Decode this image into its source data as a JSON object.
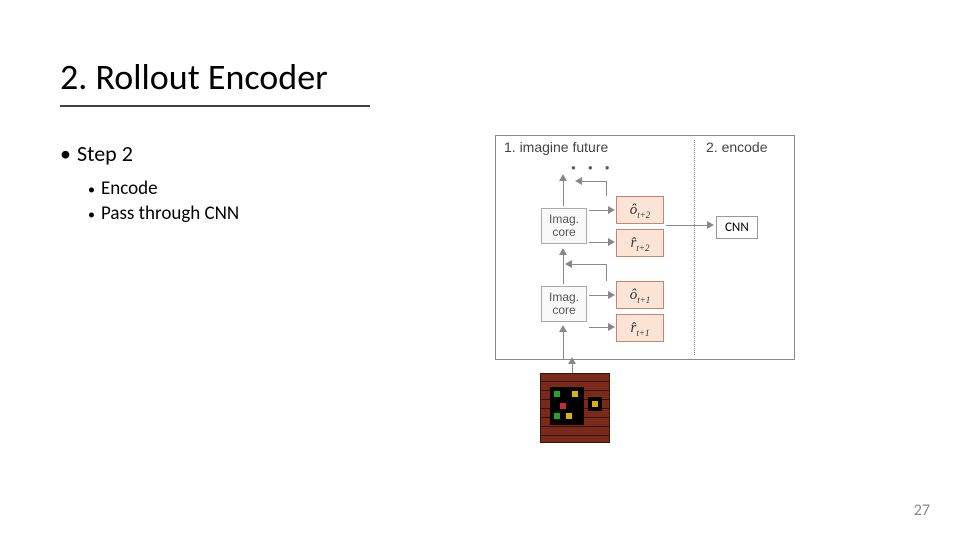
{
  "title": "2. Rollout Encoder",
  "bullet_step": "Step 2",
  "sub_bullets": [
    "Encode",
    "Pass through CNN"
  ],
  "diagram": {
    "section_left": "1. imagine future",
    "section_right": "2. encode",
    "core_label": "Imag. core",
    "o_t2": "ô",
    "o_t2_sub": "t+2",
    "r_t2": "r̂",
    "r_t2_sub": "t+2",
    "o_t1": "ô",
    "o_t1_sub": "t+1",
    "r_t1": "r̂",
    "r_t1_sub": "t+1",
    "cnn": "CNN",
    "dots": "· · ·"
  },
  "page_number": "27"
}
